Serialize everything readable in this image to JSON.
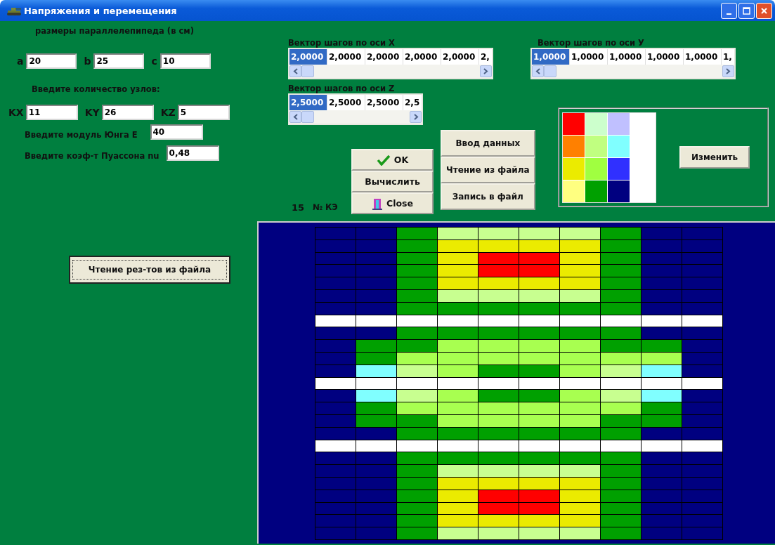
{
  "window": {
    "title": "Напряжения и перемещения"
  },
  "dimensions": {
    "title": "размеры параллелепипеда (в см)",
    "fields": [
      {
        "label": "a",
        "value": "20"
      },
      {
        "label": "b",
        "value": "25"
      },
      {
        "label": "c",
        "value": "10"
      }
    ]
  },
  "nodes": {
    "title": "Введите количество узлов:",
    "fields": [
      {
        "label": "KX",
        "value": "11"
      },
      {
        "label": "KY",
        "value": "26"
      },
      {
        "label": "KZ",
        "value": "5"
      }
    ]
  },
  "young": {
    "label": "Введите модуль Юнга E",
    "value": "40"
  },
  "poisson": {
    "label": "Введите коэф-т Пуассона nu",
    "value": "0,48"
  },
  "read_results_button": "Чтение рез-тов из файла",
  "vectors": [
    {
      "label": "Вектор шагов по оси X",
      "cells": [
        {
          "value": "2,0000",
          "selected": true
        },
        {
          "value": "2,0000",
          "selected": false
        },
        {
          "value": "2,0000",
          "selected": false
        },
        {
          "value": "2,0000",
          "selected": false
        },
        {
          "value": "2,0000",
          "selected": false
        },
        {
          "value": "2,",
          "selected": false
        }
      ]
    },
    {
      "label": "Вектор шагов по оси У",
      "cells": [
        {
          "value": "1,0000",
          "selected": true
        },
        {
          "value": "1,0000",
          "selected": false
        },
        {
          "value": "1,0000",
          "selected": false
        },
        {
          "value": "1,0000",
          "selected": false
        },
        {
          "value": "1,0000",
          "selected": false
        },
        {
          "value": "1,",
          "selected": false
        }
      ]
    },
    {
      "label": "Вектор шагов по оси Z",
      "cells": [
        {
          "value": "2,5000",
          "selected": true
        },
        {
          "value": "2,5000",
          "selected": false
        },
        {
          "value": "2,5000",
          "selected": false
        },
        {
          "value": "2,5",
          "selected": false
        }
      ]
    }
  ],
  "buttons_main": [
    {
      "label": "OK",
      "kind": "check"
    },
    {
      "label": "Вычислить",
      "kind": "plain"
    },
    {
      "label": "Close",
      "kind": "door"
    }
  ],
  "buttons_file": [
    "Ввод данных",
    "Чтение из файла",
    "Запись в файл"
  ],
  "element_counter": {
    "value": "15",
    "label": "№ КЭ"
  },
  "palette": {
    "swatches": [
      {
        "color": "#ff0000"
      },
      {
        "color": "#ff8000"
      },
      {
        "color": "#ebeb00"
      },
      {
        "color": "#ffff80"
      },
      {
        "color": "#ccffcc"
      },
      {
        "color": "#c0ff80"
      },
      {
        "color": "#a0ff40"
      },
      {
        "color": "#00a000"
      },
      {
        "color": "#c0c0ff"
      },
      {
        "color": "#80ffff"
      },
      {
        "color": "#3030ff"
      },
      {
        "color": "#000080"
      }
    ],
    "button": "Изменить"
  },
  "grid": {
    "rows": [
      [
        {
          "color": "#000080"
        },
        {
          "color": "#000080"
        },
        {
          "color": "#00a000"
        },
        {
          "color": "#c8ff90"
        },
        {
          "color": "#c8ff90"
        },
        {
          "color": "#c8ff90"
        },
        {
          "color": "#c8ff90"
        },
        {
          "color": "#00a000"
        },
        {
          "color": "#000080"
        },
        {
          "color": "#000080"
        }
      ],
      [
        {
          "color": "#000080"
        },
        {
          "color": "#000080"
        },
        {
          "color": "#00a000"
        },
        {
          "color": "#ebeb00"
        },
        {
          "color": "#ebeb00"
        },
        {
          "color": "#ebeb00"
        },
        {
          "color": "#ebeb00"
        },
        {
          "color": "#00a000"
        },
        {
          "color": "#000080"
        },
        {
          "color": "#000080"
        }
      ],
      [
        {
          "color": "#000080"
        },
        {
          "color": "#000080"
        },
        {
          "color": "#00a000"
        },
        {
          "color": "#ebeb00"
        },
        {
          "color": "#ff0000"
        },
        {
          "color": "#ff0000"
        },
        {
          "color": "#ebeb00"
        },
        {
          "color": "#00a000"
        },
        {
          "color": "#000080"
        },
        {
          "color": "#000080"
        }
      ],
      [
        {
          "color": "#000080"
        },
        {
          "color": "#000080"
        },
        {
          "color": "#00a000"
        },
        {
          "color": "#ebeb00"
        },
        {
          "color": "#ff0000"
        },
        {
          "color": "#ff0000"
        },
        {
          "color": "#ebeb00"
        },
        {
          "color": "#00a000"
        },
        {
          "color": "#000080"
        },
        {
          "color": "#000080"
        }
      ],
      [
        {
          "color": "#000080"
        },
        {
          "color": "#000080"
        },
        {
          "color": "#00a000"
        },
        {
          "color": "#ebeb00"
        },
        {
          "color": "#ebeb00"
        },
        {
          "color": "#ebeb00"
        },
        {
          "color": "#ebeb00"
        },
        {
          "color": "#00a000"
        },
        {
          "color": "#000080"
        },
        {
          "color": "#000080"
        }
      ],
      [
        {
          "color": "#000080"
        },
        {
          "color": "#000080"
        },
        {
          "color": "#00a000"
        },
        {
          "color": "#c8ff90"
        },
        {
          "color": "#c8ff90"
        },
        {
          "color": "#c8ff90"
        },
        {
          "color": "#c8ff90"
        },
        {
          "color": "#00a000"
        },
        {
          "color": "#000080"
        },
        {
          "color": "#000080"
        }
      ],
      [
        {
          "color": "#000080"
        },
        {
          "color": "#000080"
        },
        {
          "color": "#00a000"
        },
        {
          "color": "#00a000"
        },
        {
          "color": "#00a000"
        },
        {
          "color": "#00a000"
        },
        {
          "color": "#00a000"
        },
        {
          "color": "#00a000"
        },
        {
          "color": "#000080"
        },
        {
          "color": "#000080"
        }
      ],
      [
        {
          "color": "#ffffff"
        },
        {
          "color": "#ffffff"
        },
        {
          "color": "#ffffff"
        },
        {
          "color": "#ffffff"
        },
        {
          "color": "#ffffff"
        },
        {
          "color": "#ffffff"
        },
        {
          "color": "#ffffff"
        },
        {
          "color": "#ffffff"
        },
        {
          "color": "#ffffff"
        },
        {
          "color": "#ffffff"
        }
      ],
      [
        {
          "color": "#000080"
        },
        {
          "color": "#000080"
        },
        {
          "color": "#00a000"
        },
        {
          "color": "#00a000"
        },
        {
          "color": "#00a000"
        },
        {
          "color": "#00a000"
        },
        {
          "color": "#00a000"
        },
        {
          "color": "#00a000"
        },
        {
          "color": "#000080"
        },
        {
          "color": "#000080"
        }
      ],
      [
        {
          "color": "#000080"
        },
        {
          "color": "#00a000"
        },
        {
          "color": "#00a000"
        },
        {
          "color": "#a8ff50"
        },
        {
          "color": "#a8ff50"
        },
        {
          "color": "#a8ff50"
        },
        {
          "color": "#a8ff50"
        },
        {
          "color": "#00a000"
        },
        {
          "color": "#00a000"
        },
        {
          "color": "#000080"
        }
      ],
      [
        {
          "color": "#000080"
        },
        {
          "color": "#00a000"
        },
        {
          "color": "#a8ff50"
        },
        {
          "color": "#a8ff50"
        },
        {
          "color": "#a8ff50"
        },
        {
          "color": "#a8ff50"
        },
        {
          "color": "#a8ff50"
        },
        {
          "color": "#a8ff50"
        },
        {
          "color": "#a8ff50"
        },
        {
          "color": "#000080"
        }
      ],
      [
        {
          "color": "#000080"
        },
        {
          "color": "#80ffff"
        },
        {
          "color": "#c8ff90"
        },
        {
          "color": "#a8ff50"
        },
        {
          "color": "#00a000"
        },
        {
          "color": "#00a000"
        },
        {
          "color": "#a8ff50"
        },
        {
          "color": "#c8ff90"
        },
        {
          "color": "#80ffff"
        },
        {
          "color": "#000080"
        }
      ],
      [
        {
          "color": "#ffffff"
        },
        {
          "color": "#ffffff"
        },
        {
          "color": "#ffffff"
        },
        {
          "color": "#ffffff"
        },
        {
          "color": "#ffffff"
        },
        {
          "color": "#ffffff"
        },
        {
          "color": "#ffffff"
        },
        {
          "color": "#ffffff"
        },
        {
          "color": "#ffffff"
        },
        {
          "color": "#ffffff"
        }
      ],
      [
        {
          "color": "#000080"
        },
        {
          "color": "#80ffff"
        },
        {
          "color": "#c8ff90"
        },
        {
          "color": "#a8ff50"
        },
        {
          "color": "#00a000"
        },
        {
          "color": "#00a000"
        },
        {
          "color": "#a8ff50"
        },
        {
          "color": "#c8ff90"
        },
        {
          "color": "#80ffff"
        },
        {
          "color": "#000080"
        }
      ],
      [
        {
          "color": "#000080"
        },
        {
          "color": "#00a000"
        },
        {
          "color": "#a8ff50"
        },
        {
          "color": "#a8ff50"
        },
        {
          "color": "#a8ff50"
        },
        {
          "color": "#a8ff50"
        },
        {
          "color": "#a8ff50"
        },
        {
          "color": "#a8ff50"
        },
        {
          "color": "#00a000"
        },
        {
          "color": "#000080"
        }
      ],
      [
        {
          "color": "#000080"
        },
        {
          "color": "#00a000"
        },
        {
          "color": "#00a000"
        },
        {
          "color": "#a8ff50"
        },
        {
          "color": "#a8ff50"
        },
        {
          "color": "#a8ff50"
        },
        {
          "color": "#a8ff50"
        },
        {
          "color": "#00a000"
        },
        {
          "color": "#00a000"
        },
        {
          "color": "#000080"
        }
      ],
      [
        {
          "color": "#000080"
        },
        {
          "color": "#000080"
        },
        {
          "color": "#00a000"
        },
        {
          "color": "#00a000"
        },
        {
          "color": "#00a000"
        },
        {
          "color": "#00a000"
        },
        {
          "color": "#00a000"
        },
        {
          "color": "#00a000"
        },
        {
          "color": "#000080"
        },
        {
          "color": "#000080"
        }
      ],
      [
        {
          "color": "#ffffff"
        },
        {
          "color": "#ffffff"
        },
        {
          "color": "#ffffff"
        },
        {
          "color": "#ffffff"
        },
        {
          "color": "#ffffff"
        },
        {
          "color": "#ffffff"
        },
        {
          "color": "#ffffff"
        },
        {
          "color": "#ffffff"
        },
        {
          "color": "#ffffff"
        },
        {
          "color": "#ffffff"
        }
      ],
      [
        {
          "color": "#000080"
        },
        {
          "color": "#000080"
        },
        {
          "color": "#00a000"
        },
        {
          "color": "#00a000"
        },
        {
          "color": "#00a000"
        },
        {
          "color": "#00a000"
        },
        {
          "color": "#00a000"
        },
        {
          "color": "#00a000"
        },
        {
          "color": "#000080"
        },
        {
          "color": "#000080"
        }
      ],
      [
        {
          "color": "#000080"
        },
        {
          "color": "#000080"
        },
        {
          "color": "#00a000"
        },
        {
          "color": "#c8ff90"
        },
        {
          "color": "#c8ff90"
        },
        {
          "color": "#c8ff90"
        },
        {
          "color": "#c8ff90"
        },
        {
          "color": "#00a000"
        },
        {
          "color": "#000080"
        },
        {
          "color": "#000080"
        }
      ],
      [
        {
          "color": "#000080"
        },
        {
          "color": "#000080"
        },
        {
          "color": "#00a000"
        },
        {
          "color": "#ebeb00"
        },
        {
          "color": "#ebeb00"
        },
        {
          "color": "#ebeb00"
        },
        {
          "color": "#ebeb00"
        },
        {
          "color": "#00a000"
        },
        {
          "color": "#000080"
        },
        {
          "color": "#000080"
        }
      ],
      [
        {
          "color": "#000080"
        },
        {
          "color": "#000080"
        },
        {
          "color": "#00a000"
        },
        {
          "color": "#ebeb00"
        },
        {
          "color": "#ff0000"
        },
        {
          "color": "#ff0000"
        },
        {
          "color": "#ebeb00"
        },
        {
          "color": "#00a000"
        },
        {
          "color": "#000080"
        },
        {
          "color": "#000080"
        }
      ],
      [
        {
          "color": "#000080"
        },
        {
          "color": "#000080"
        },
        {
          "color": "#00a000"
        },
        {
          "color": "#ebeb00"
        },
        {
          "color": "#ff0000"
        },
        {
          "color": "#ff0000"
        },
        {
          "color": "#ebeb00"
        },
        {
          "color": "#00a000"
        },
        {
          "color": "#000080"
        },
        {
          "color": "#000080"
        }
      ],
      [
        {
          "color": "#000080"
        },
        {
          "color": "#000080"
        },
        {
          "color": "#00a000"
        },
        {
          "color": "#ebeb00"
        },
        {
          "color": "#ebeb00"
        },
        {
          "color": "#ebeb00"
        },
        {
          "color": "#ebeb00"
        },
        {
          "color": "#00a000"
        },
        {
          "color": "#000080"
        },
        {
          "color": "#000080"
        }
      ],
      [
        {
          "color": "#000080"
        },
        {
          "color": "#000080"
        },
        {
          "color": "#00a000"
        },
        {
          "color": "#c8ff90"
        },
        {
          "color": "#c8ff90"
        },
        {
          "color": "#c8ff90"
        },
        {
          "color": "#c8ff90"
        },
        {
          "color": "#00a000"
        },
        {
          "color": "#000080"
        },
        {
          "color": "#000080"
        }
      ]
    ]
  }
}
